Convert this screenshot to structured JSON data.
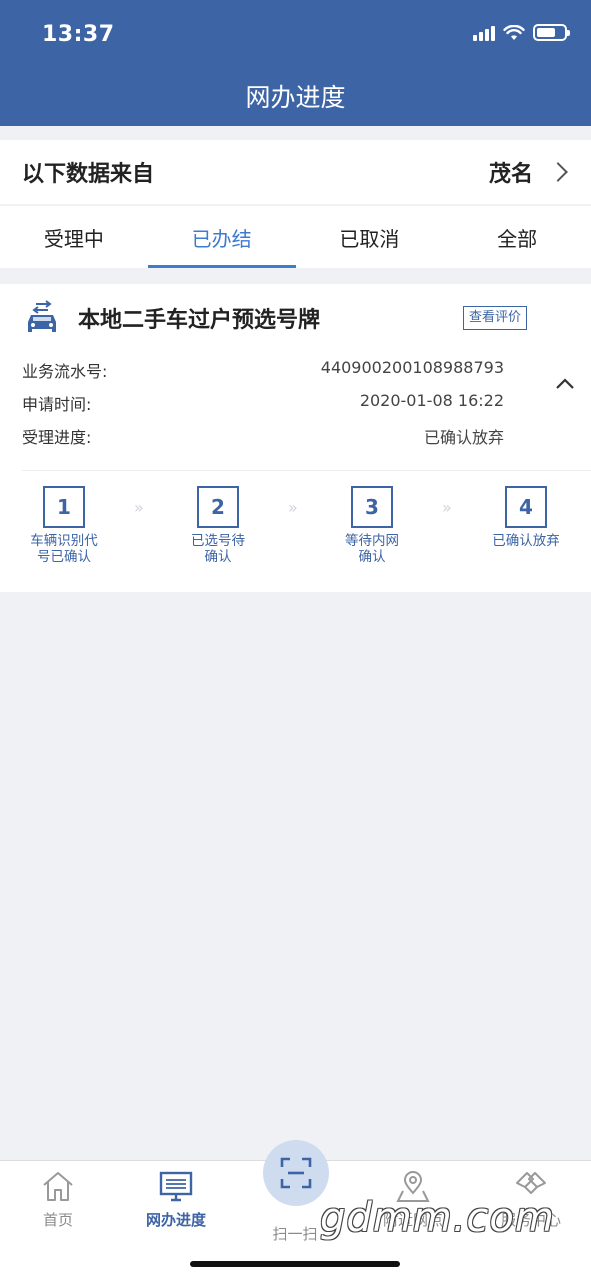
{
  "status": {
    "time": "13:37"
  },
  "header": {
    "title": "网办进度"
  },
  "source": {
    "label": "以下数据来自",
    "city": "茂名"
  },
  "tabs": [
    {
      "label": "受理中",
      "active": false
    },
    {
      "label": "已办结",
      "active": true
    },
    {
      "label": "已取消",
      "active": false
    },
    {
      "label": "全部",
      "active": false
    }
  ],
  "card": {
    "title": "本地二手车过户预选号牌",
    "review_button": "查看评价",
    "rows": [
      {
        "label": "业务流水号:",
        "value": "440900200108988793"
      },
      {
        "label": "申请时间:",
        "value": "2020-01-08 16:22"
      },
      {
        "label": "受理进度:",
        "value": "已确认放弃"
      }
    ],
    "steps": [
      {
        "num": "1",
        "label_line1": "车辆识别代",
        "label_line2": "号已确认"
      },
      {
        "num": "2",
        "label_line1": "已选号待",
        "label_line2": "确认"
      },
      {
        "num": "3",
        "label_line1": "等待内网",
        "label_line2": "确认"
      },
      {
        "num": "4",
        "label_line1": "已确认放弃",
        "label_line2": ""
      }
    ],
    "step_arrow": "»"
  },
  "bottom_nav": [
    {
      "label": "首页",
      "icon": "home-icon",
      "active": false
    },
    {
      "label": "网办进度",
      "icon": "monitor-icon",
      "active": true
    },
    {
      "label": "扫一扫",
      "icon": "scan-icon",
      "active": false
    },
    {
      "label": "附近网点",
      "icon": "location-icon",
      "active": false
    },
    {
      "label": "服务中心",
      "icon": "handshake-icon",
      "active": false
    }
  ],
  "watermark": "gdmm.com",
  "colors": {
    "brand": "#3d64a5",
    "accent": "#3d7bd1",
    "background": "#f0f1f5"
  }
}
